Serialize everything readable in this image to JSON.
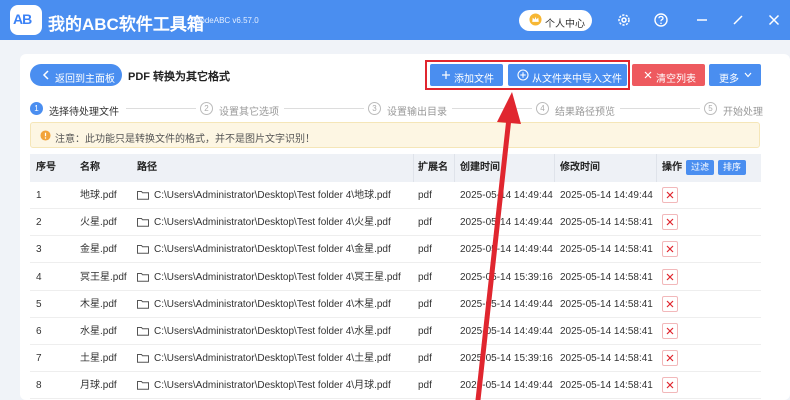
{
  "app": {
    "title": "我的ABC软件工具箱",
    "version": "WodeABC v6.57.0",
    "logo_text": "AB",
    "user_center_label": "个人中心"
  },
  "header": {
    "back_label": "返回到主面板",
    "page_title": "PDF 转换为其它格式"
  },
  "toolbar": {
    "add_file": "添加文件",
    "import_folder": "从文件夹中导入文件",
    "clear_list": "清空列表",
    "more": "更多"
  },
  "steps": [
    {
      "num": "1",
      "label": "选择待处理文件"
    },
    {
      "num": "2",
      "label": "设置其它选项"
    },
    {
      "num": "3",
      "label": "设置输出目录"
    },
    {
      "num": "4",
      "label": "结果路径预览"
    },
    {
      "num": "5",
      "label": "开始处理"
    }
  ],
  "notice": "注意：此功能只是转换文件的格式，并不是图片文字识别！",
  "table": {
    "headers": {
      "no": "序号",
      "name": "名称",
      "path": "路径",
      "ext": "扩展名",
      "ctime": "创建时间",
      "mtime": "修改时间",
      "ops": "操作",
      "filter": "过滤",
      "sort": "排序"
    },
    "rows": [
      {
        "no": "1",
        "name": "地球.pdf",
        "path": "C:\\Users\\Administrator\\Desktop\\Test folder 4\\地球.pdf",
        "ext": "pdf",
        "ctime": "2025-05-14 14:49:44",
        "mtime": "2025-05-14 14:49:44"
      },
      {
        "no": "2",
        "name": "火星.pdf",
        "path": "C:\\Users\\Administrator\\Desktop\\Test folder 4\\火星.pdf",
        "ext": "pdf",
        "ctime": "2025-05-14 14:49:44",
        "mtime": "2025-05-14 14:58:41"
      },
      {
        "no": "3",
        "name": "金星.pdf",
        "path": "C:\\Users\\Administrator\\Desktop\\Test folder 4\\金星.pdf",
        "ext": "pdf",
        "ctime": "2025-05-14 14:49:44",
        "mtime": "2025-05-14 14:58:41"
      },
      {
        "no": "4",
        "name": "冥王星.pdf",
        "path": "C:\\Users\\Administrator\\Desktop\\Test folder 4\\冥王星.pdf",
        "ext": "pdf",
        "ctime": "2025-05-14 15:39:16",
        "mtime": "2025-05-14 14:58:41"
      },
      {
        "no": "5",
        "name": "木星.pdf",
        "path": "C:\\Users\\Administrator\\Desktop\\Test folder 4\\木星.pdf",
        "ext": "pdf",
        "ctime": "2025-05-14 14:49:44",
        "mtime": "2025-05-14 14:58:41"
      },
      {
        "no": "6",
        "name": "水星.pdf",
        "path": "C:\\Users\\Administrator\\Desktop\\Test folder 4\\水星.pdf",
        "ext": "pdf",
        "ctime": "2025-05-14 14:49:44",
        "mtime": "2025-05-14 14:58:41"
      },
      {
        "no": "7",
        "name": "土星.pdf",
        "path": "C:\\Users\\Administrator\\Desktop\\Test folder 4\\土星.pdf",
        "ext": "pdf",
        "ctime": "2025-05-14 15:39:16",
        "mtime": "2025-05-14 14:58:41"
      },
      {
        "no": "8",
        "name": "月球.pdf",
        "path": "C:\\Users\\Administrator\\Desktop\\Test folder 4\\月球.pdf",
        "ext": "pdf",
        "ctime": "2025-05-14 14:49:44",
        "mtime": "2025-05-14 14:58:41"
      }
    ]
  },
  "icons": {
    "crown": "crown-icon",
    "settings": "gear-icon",
    "help": "help-icon",
    "minimize": "minimize-icon",
    "close": "close-icon",
    "folder": "folder-icon",
    "delete": "delete-icon"
  },
  "colors": {
    "primary": "#4a8ef0",
    "danger": "#ee5a5f",
    "highlight": "#e0262f",
    "notice_bg": "#fdf6e3"
  }
}
